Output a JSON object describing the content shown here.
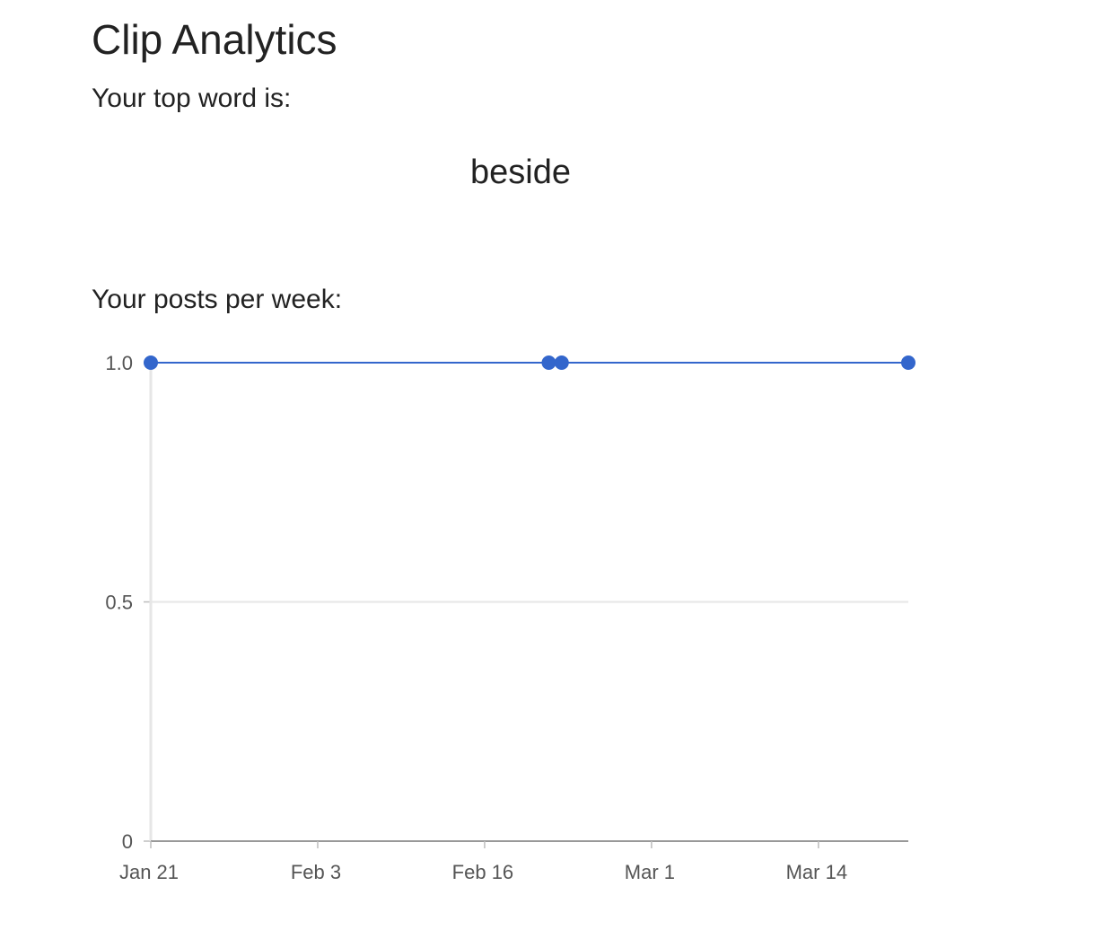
{
  "page": {
    "title": "Clip Analytics",
    "top_word_label": "Your top word is:",
    "top_word": "beside",
    "posts_label": "Your posts per week:"
  },
  "chart_data": {
    "type": "line",
    "x_axis_type": "date",
    "x_tick_labels": [
      "Jan 21",
      "Feb 3",
      "Feb 16",
      "Mar 1",
      "Mar 14"
    ],
    "y_tick_labels": [
      "1.0",
      "0.5",
      "0"
    ],
    "ylim": [
      0,
      1
    ],
    "grid": true,
    "legend": "none",
    "series": [
      {
        "color": "#3366cc",
        "points": [
          {
            "x": "Jan 21",
            "y": 1
          },
          {
            "x": "Feb 21",
            "y": 1
          },
          {
            "x": "Feb 22",
            "y": 1
          },
          {
            "x": "Mar 21",
            "y": 1
          }
        ]
      }
    ]
  }
}
